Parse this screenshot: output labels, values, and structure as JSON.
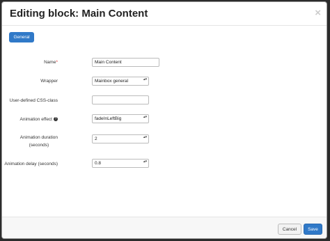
{
  "modal": {
    "title": "Editing block: Main Content",
    "close_glyph": "×"
  },
  "tabs": [
    {
      "label": "General"
    }
  ],
  "form": {
    "name": {
      "label": "Name",
      "required_mark": "*",
      "value": "Main Content"
    },
    "wrapper": {
      "label": "Wrapper",
      "value": "Mainbox general"
    },
    "css_class": {
      "label": "User-defined CSS-class",
      "value": ""
    },
    "animation_effect": {
      "label": "Animation effect",
      "help_glyph": "?",
      "value": "fadeInLeftBig"
    },
    "animation_duration": {
      "label_line1": "Animation duration",
      "label_line2": "(seconds)",
      "value": "2"
    },
    "animation_delay": {
      "label": "Animation delay (seconds)",
      "value": "0.8"
    }
  },
  "footer": {
    "cancel_label": "Cancel",
    "save_label": "Save"
  },
  "colors": {
    "primary": "#3079c8",
    "required": "#d33333"
  },
  "select_arrow_glyph": "▴▾"
}
